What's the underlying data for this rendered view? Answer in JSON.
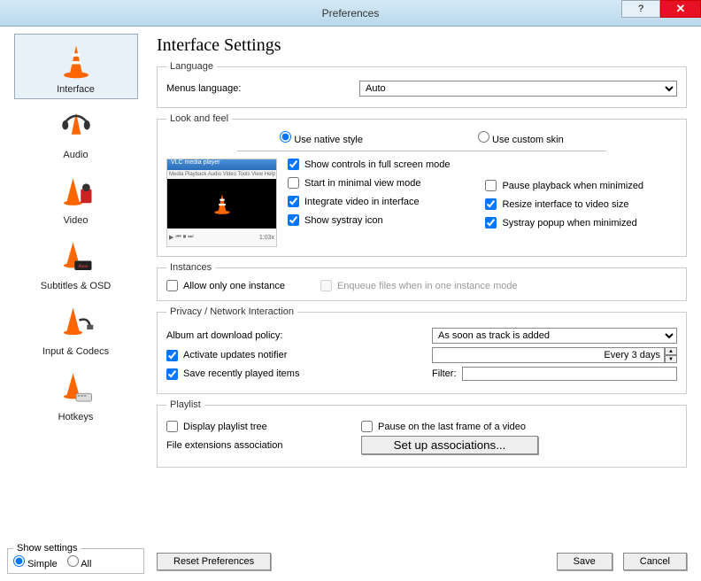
{
  "window": {
    "title": "Preferences"
  },
  "sidebar": {
    "items": [
      {
        "label": "Interface",
        "selected": true
      },
      {
        "label": "Audio"
      },
      {
        "label": "Video"
      },
      {
        "label": "Subtitles & OSD"
      },
      {
        "label": "Input & Codecs"
      },
      {
        "label": "Hotkeys"
      }
    ],
    "show_settings": {
      "legend": "Show settings",
      "simple": "Simple",
      "all": "All"
    }
  },
  "page": {
    "title": "Interface Settings"
  },
  "language": {
    "legend": "Language",
    "label": "Menus language:",
    "value": "Auto"
  },
  "look": {
    "legend": "Look and feel",
    "use_native": "Use native style",
    "use_custom": "Use custom skin",
    "preview_title": "VLC media player",
    "preview_menu": "Media Playback Audio Video Tools View Help",
    "preview_time": "1:03x",
    "checks_left": [
      {
        "label": "Show controls in full screen mode",
        "checked": true
      },
      {
        "label": "Start in minimal view mode",
        "checked": false
      },
      {
        "label": "Integrate video in interface",
        "checked": true
      },
      {
        "label": "Show systray icon",
        "checked": true
      }
    ],
    "checks_right": [
      {
        "label": "Pause playback when minimized",
        "checked": false
      },
      {
        "label": "Resize interface to video size",
        "checked": true
      },
      {
        "label": "Systray popup when minimized",
        "checked": true
      }
    ]
  },
  "instances": {
    "legend": "Instances",
    "allow_one": "Allow only one instance",
    "enqueue": "Enqueue files when in one instance mode"
  },
  "privacy": {
    "legend": "Privacy / Network Interaction",
    "album_label": "Album art download policy:",
    "album_value": "As soon as track is added",
    "updates_label": "Activate updates notifier",
    "updates_value": "Every 3 days",
    "save_recent_label": "Save recently played items",
    "filter_label": "Filter:",
    "filter_value": ""
  },
  "playlist": {
    "legend": "Playlist",
    "display_tree": "Display playlist tree",
    "pause_last": "Pause on the last frame of a video",
    "assoc_label": "File extensions association",
    "assoc_button": "Set up associations..."
  },
  "footer": {
    "reset": "Reset Preferences",
    "save": "Save",
    "cancel": "Cancel"
  }
}
